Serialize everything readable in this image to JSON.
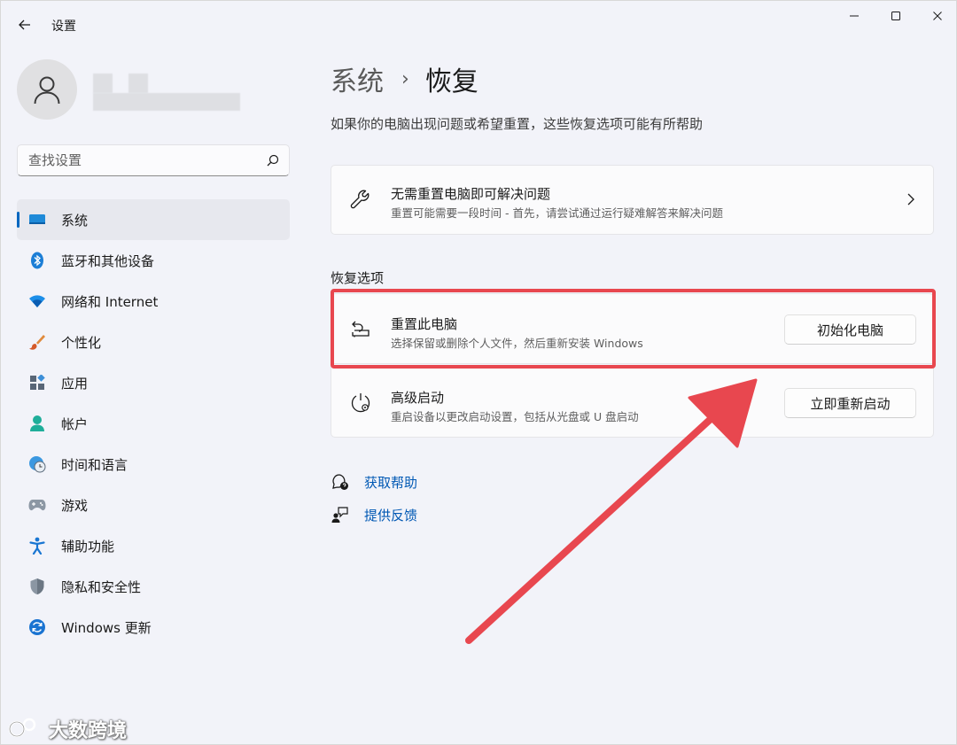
{
  "window": {
    "title": "设置",
    "controls": [
      "minimize",
      "maximize",
      "close"
    ]
  },
  "sidebar": {
    "search_placeholder": "查找设置",
    "items": [
      {
        "label": "系统",
        "icon": "monitor-icon",
        "active": true
      },
      {
        "label": "蓝牙和其他设备",
        "icon": "bluetooth-icon",
        "active": false
      },
      {
        "label": "网络和 Internet",
        "icon": "wifi-icon",
        "active": false
      },
      {
        "label": "个性化",
        "icon": "brush-icon",
        "active": false
      },
      {
        "label": "应用",
        "icon": "apps-icon",
        "active": false
      },
      {
        "label": "帐户",
        "icon": "account-icon",
        "active": false
      },
      {
        "label": "时间和语言",
        "icon": "globe-clock-icon",
        "active": false
      },
      {
        "label": "游戏",
        "icon": "gamepad-icon",
        "active": false
      },
      {
        "label": "辅助功能",
        "icon": "accessibility-icon",
        "active": false
      },
      {
        "label": "隐私和安全性",
        "icon": "shield-icon",
        "active": false
      },
      {
        "label": "Windows 更新",
        "icon": "update-icon",
        "active": false
      }
    ]
  },
  "main": {
    "breadcrumb_parent": "系统",
    "breadcrumb_current": "恢复",
    "description": "如果你的电脑出现问题或希望重置，这些恢复选项可能有所帮助",
    "troubleshoot": {
      "title": "无需重置电脑即可解决问题",
      "subtitle": "重置可能需要一段时间 - 首先，请尝试通过运行疑难解答来解决问题"
    },
    "section_title": "恢复选项",
    "reset": {
      "title": "重置此电脑",
      "subtitle": "选择保留或删除个人文件，然后重新安装 Windows",
      "button": "初始化电脑"
    },
    "advanced": {
      "title": "高级启动",
      "subtitle": "重启设备以更改启动设置，包括从光盘或 U 盘启动",
      "button": "立即重新启动"
    },
    "links": {
      "help": "获取帮助",
      "feedback": "提供反馈"
    }
  },
  "watermark": "大数跨境",
  "colors": {
    "accent": "#0067c0",
    "link": "#0058b4",
    "annotation": "#e8474f"
  }
}
